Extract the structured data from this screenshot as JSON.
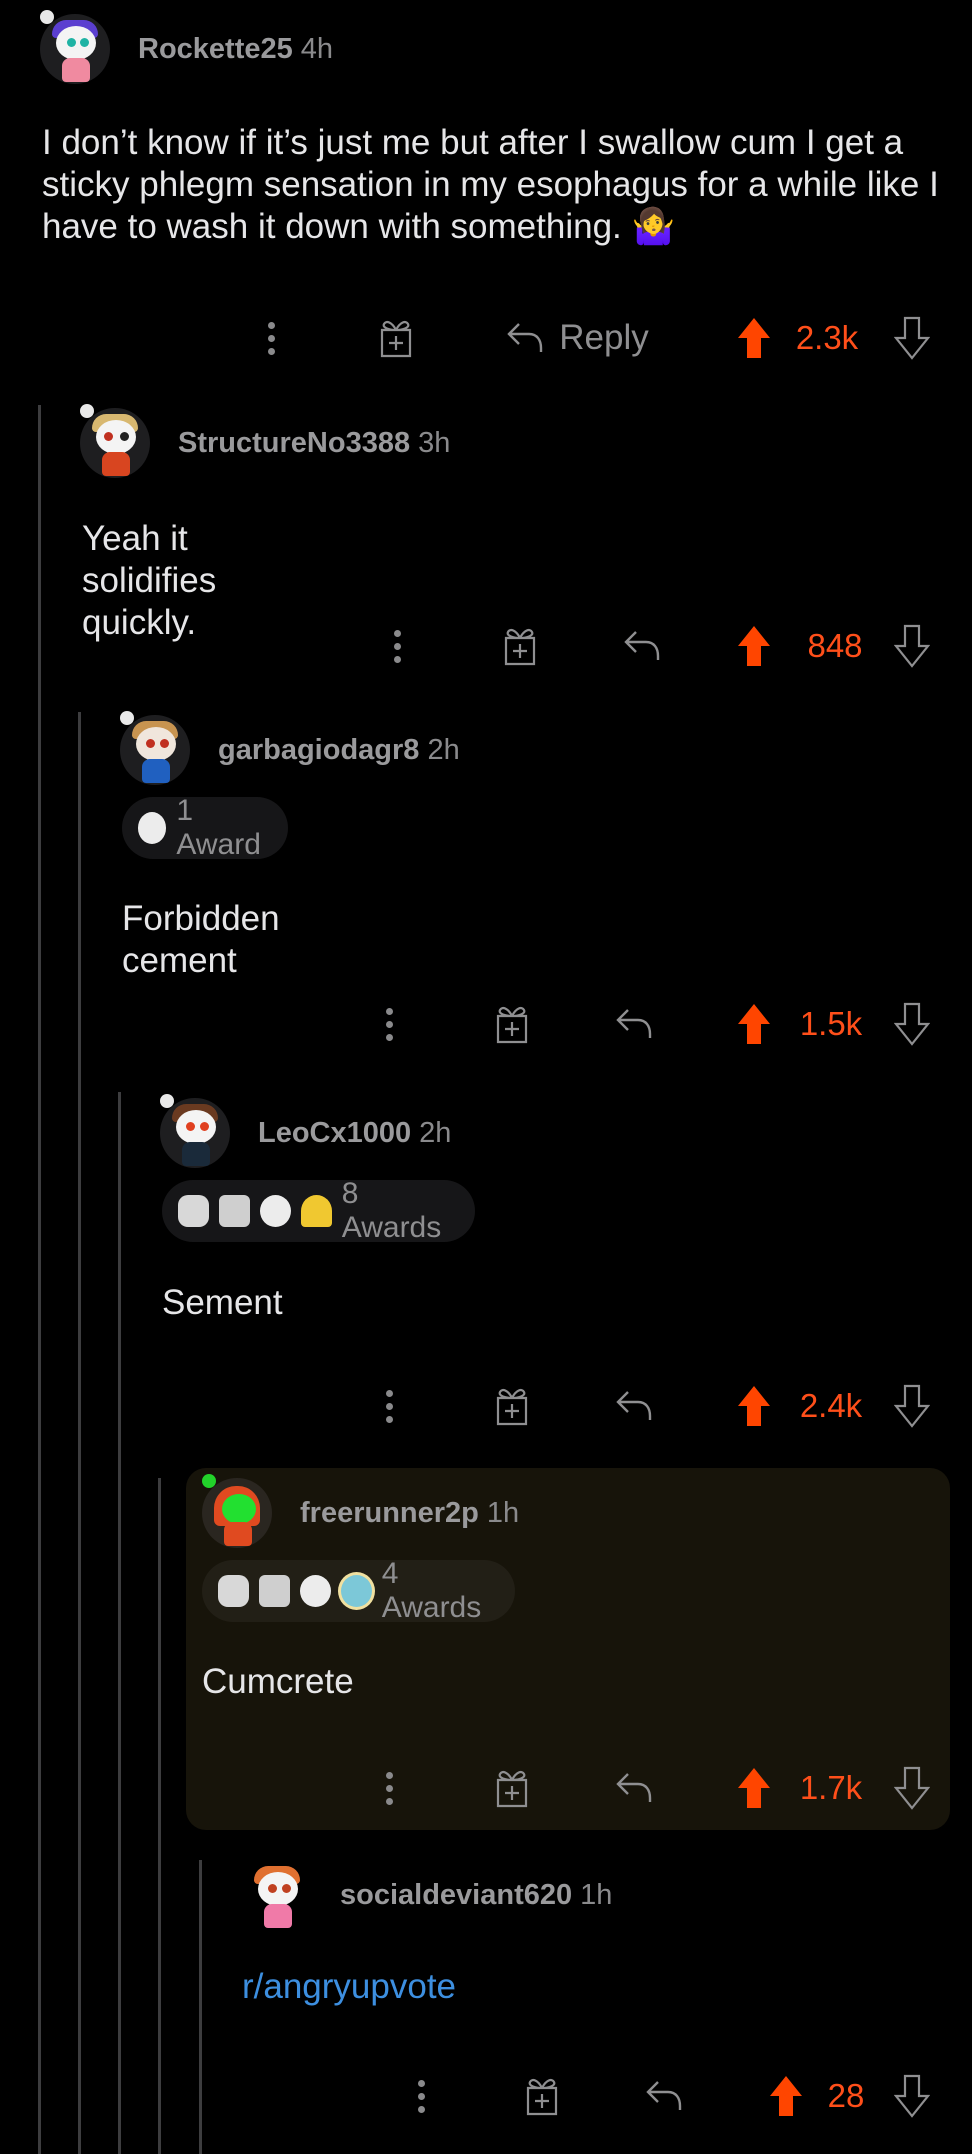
{
  "colors": {
    "background": "#000000",
    "upvote_active": "#ff4500",
    "score_text": "#ff4f1a",
    "username": "#9a9a9c",
    "body_text": "#e6e6e8",
    "link": "#3d8fe0",
    "thread_line": "#3d3d3f",
    "highlight_card": "#17140a"
  },
  "icons": {
    "more": "more-vertical-icon",
    "gift": "gift-award-icon",
    "reply": "reply-arrow-icon",
    "upvote": "upvote-arrow-icon",
    "downvote": "downvote-arrow-icon"
  },
  "comments": [
    {
      "username": "Rockette25",
      "age": "4h",
      "body": "I don’t know if it’s just me but after I swallow cum I get a sticky phlegm sensation in my esophagus for a while like I have to wash it down with something. 🤷‍♀️",
      "reply_label": "Reply",
      "score": "2.3k",
      "upvoted": true
    },
    {
      "username": "StructureNo3388",
      "age": "3h",
      "body": "Yeah it solidifies quickly.",
      "score": "848",
      "upvoted": true
    },
    {
      "username": "garbagiodagr8",
      "age": "2h",
      "awards_label": "1 Award",
      "award_icons": [
        "seal-award-icon"
      ],
      "body": "Forbidden cement",
      "score": "1.5k",
      "upvoted": true
    },
    {
      "username": "LeoCx1000",
      "age": "2h",
      "awards_label": "8 Awards",
      "award_icons": [
        "silver-coin-award-icon",
        "handshake-award-icon",
        "seal-award-icon",
        "illuminati-pyramid-award-icon"
      ],
      "body": "Sement",
      "score": "2.4k",
      "upvoted": true
    },
    {
      "username": "freerunner2p",
      "age": "1h",
      "awards_label": "4 Awards",
      "award_icons": [
        "silver-coin-award-icon",
        "handshake-award-icon",
        "seal-award-icon",
        "shiny-seal-award-icon"
      ],
      "body": "Cumcrete",
      "score": "1.7k",
      "upvoted": true,
      "highlighted": true
    },
    {
      "username": "socialdeviant620",
      "age": "1h",
      "body": "r/angryupvote",
      "body_is_link": true,
      "score": "28",
      "upvoted": true
    }
  ]
}
